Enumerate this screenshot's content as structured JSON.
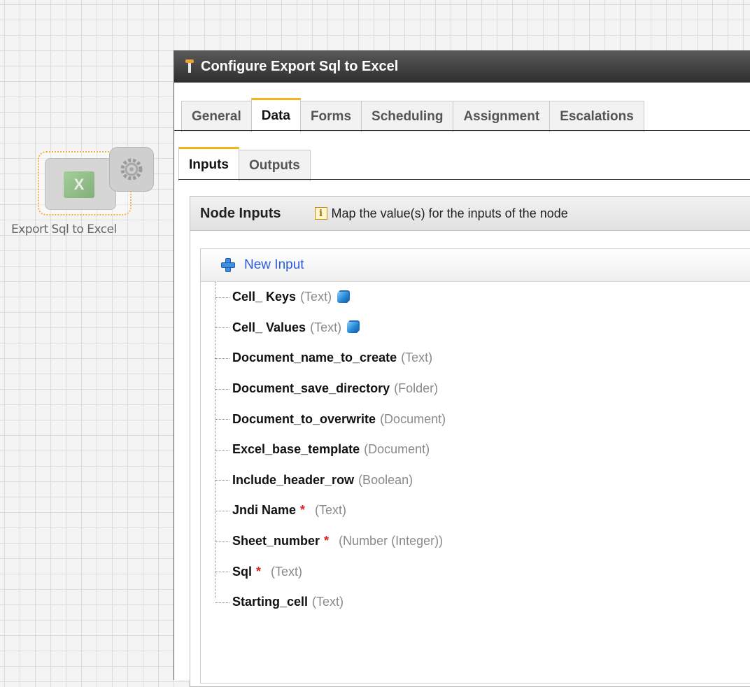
{
  "canvas": {
    "node_label": "Export Sql to Excel",
    "node_icon": "excel-icon",
    "node_badge_icon": "gear-icon"
  },
  "dialog": {
    "title": "Configure Export Sql to Excel",
    "tabs": [
      "General",
      "Data",
      "Forms",
      "Scheduling",
      "Assignment",
      "Escalations"
    ],
    "active_tab": "Data",
    "subtabs": [
      "Inputs",
      "Outputs"
    ],
    "active_subtab": "Inputs",
    "panel": {
      "title": "Node Inputs",
      "hint": "Map the value(s) for the inputs of the node",
      "new_input_label": "New Input",
      "inputs": [
        {
          "name": "Cell_ Keys",
          "type": "(Text)",
          "required": "",
          "multi": "cube-icon"
        },
        {
          "name": "Cell_ Values",
          "type": "(Text)",
          "required": "",
          "multi": "cube-icon"
        },
        {
          "name": "Document_name_to_create",
          "type": "(Text)",
          "required": ""
        },
        {
          "name": "Document_save_directory",
          "type": "(Folder)",
          "required": ""
        },
        {
          "name": "Document_to_overwrite",
          "type": "(Document)",
          "required": ""
        },
        {
          "name": "Excel_base_template",
          "type": "(Document)",
          "required": ""
        },
        {
          "name": "Include_header_row",
          "type": "(Boolean)",
          "required": ""
        },
        {
          "name": "Jndi Name",
          "type": "(Text)",
          "required": "*"
        },
        {
          "name": "Sheet_number",
          "type": "(Number (Integer))",
          "required": "*"
        },
        {
          "name": "Sql",
          "type": "(Text)",
          "required": "*"
        },
        {
          "name": "Starting_cell",
          "type": "(Text)",
          "required": ""
        }
      ]
    }
  },
  "colors": {
    "tab_accent": "#f2b21c",
    "link_blue": "#2a5bd7",
    "required_red": "#d22222",
    "type_gray": "#8a8a8a"
  }
}
